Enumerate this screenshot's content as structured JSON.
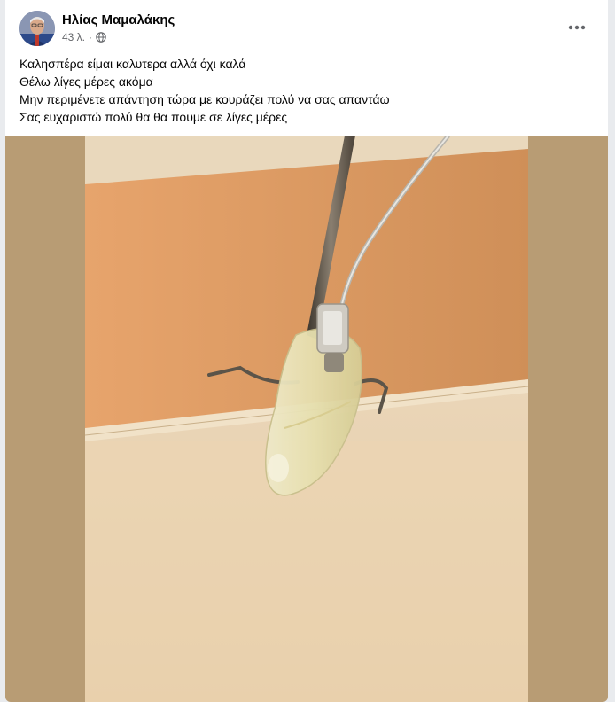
{
  "post": {
    "author": "Ηλίας Μαμαλάκης",
    "timestamp": "43 λ.",
    "separator": "·",
    "audience_icon": "globe-icon",
    "more_icon": "more-options-icon",
    "lines": [
      "Καλησπέρα είμαι καλυτερα αλλά όχι καλά",
      "Θέλω λίγες μέρες ακόμα",
      "Μην περιμένετε απάντηση τώρα με κουράζει πολύ να σας απαντάω",
      "Σας ευχαριστώ πολύ θα θα πουμε σε λίγες μέρες"
    ]
  },
  "colors": {
    "author_text": "#050505",
    "meta_text": "#65676b",
    "media_backdrop": "#b89c74",
    "wall": "#d99a64",
    "ceiling": "#e8d2b2"
  }
}
